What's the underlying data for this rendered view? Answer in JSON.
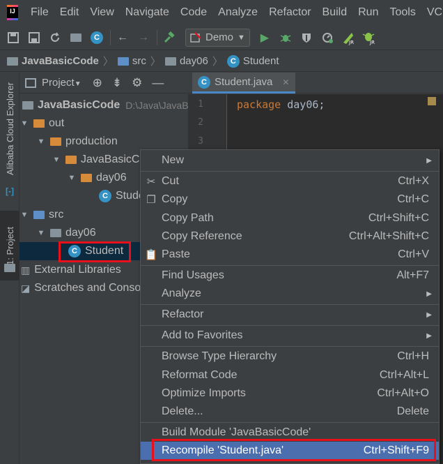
{
  "app": {
    "menu": [
      "File",
      "Edit",
      "View",
      "Navigate",
      "Code",
      "Analyze",
      "Refactor",
      "Build",
      "Run",
      "Tools",
      "VC"
    ],
    "run_config": "Demo"
  },
  "toolbar_icons": [
    "save-all-icon",
    "save-icon",
    "sync-icon",
    "folder-icon",
    "class-icon",
    "back-icon",
    "forward-icon",
    "build-hammer-icon",
    "run-icon",
    "debug-icon",
    "coverage-icon",
    "profile-icon",
    "jrebel-run-icon",
    "jrebel-debug-icon"
  ],
  "breadcrumb": {
    "project": "JavaBasicCode",
    "items": [
      "src",
      "day06",
      "Student"
    ]
  },
  "side_tabs": {
    "cloud": "Alibaba Cloud Explorer",
    "project": "1: Project"
  },
  "project_panel": {
    "title": "Project",
    "root_name": "JavaBasicCode",
    "root_path": "D:\\Java\\JavaBa",
    "out": "out",
    "production": "production",
    "module": "JavaBasicCo",
    "day06_out": "day06",
    "student_out": "Stude",
    "src": "src",
    "day06": "day06",
    "student": "Student",
    "external": "External Libraries",
    "scratches": "Scratches and Conso"
  },
  "editor": {
    "tab_label": "Student.java",
    "line_numbers": [
      "1",
      "2",
      "3"
    ],
    "keyword": "package",
    "package_name": "day06;"
  },
  "context_menu": {
    "new": "New",
    "cut": "Cut",
    "cut_key": "Ctrl+X",
    "copy": "Copy",
    "copy_key": "Ctrl+C",
    "copy_path": "Copy Path",
    "copy_path_key": "Ctrl+Shift+C",
    "copy_reference": "Copy Reference",
    "copy_reference_key": "Ctrl+Alt+Shift+C",
    "paste": "Paste",
    "paste_key": "Ctrl+V",
    "find_usages": "Find Usages",
    "find_usages_key": "Alt+F7",
    "analyze": "Analyze",
    "refactor": "Refactor",
    "add_to_favorites": "Add to Favorites",
    "browse_type_hierarchy": "Browse Type Hierarchy",
    "browse_type_hierarchy_key": "Ctrl+H",
    "reformat_code": "Reformat Code",
    "reformat_code_key": "Ctrl+Alt+L",
    "optimize_imports": "Optimize Imports",
    "optimize_imports_key": "Ctrl+Alt+O",
    "delete": "Delete...",
    "delete_key": "Delete",
    "build_module": "Build Module 'JavaBasicCode'",
    "recompile": "Recompile 'Student.java'",
    "recompile_key": "Ctrl+Shift+F9"
  },
  "colors": {
    "background": "#3c3f41",
    "editor_bg": "#2b2b2b",
    "selection": "#4b6eaf",
    "highlight_box": "#e8101a",
    "class_icon": "#3592c4"
  }
}
